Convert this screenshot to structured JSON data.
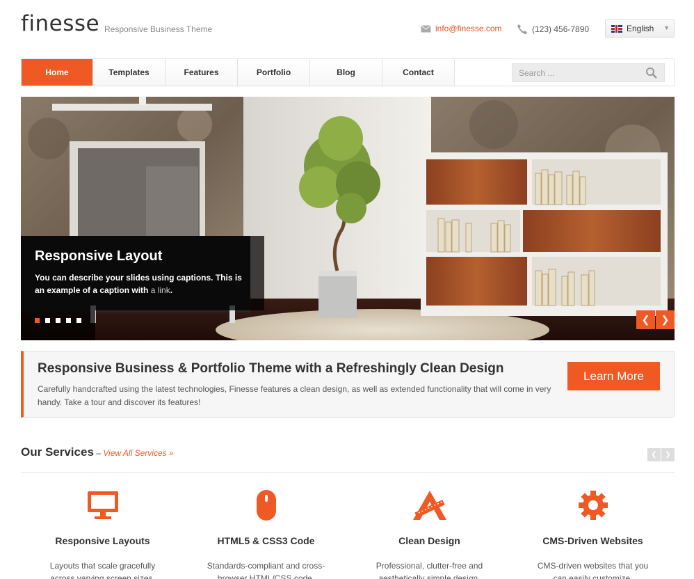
{
  "header": {
    "logo": "finesse",
    "tagline": "Responsive Business Theme",
    "email": "info@finesse.com",
    "phone": "(123) 456-7890",
    "language": "English"
  },
  "nav": {
    "items": [
      {
        "label": "Home"
      },
      {
        "label": "Templates"
      },
      {
        "label": "Features"
      },
      {
        "label": "Portfolio"
      },
      {
        "label": "Blog"
      },
      {
        "label": "Contact"
      }
    ],
    "search_placeholder": "Search ..."
  },
  "slider": {
    "caption_title": "Responsive Layout",
    "caption_text": "You can describe your slides using captions. This is an example of a caption with",
    "caption_link": "a link",
    "caption_end": ".",
    "slide_count": 5,
    "active_slide": 1
  },
  "intro": {
    "title": "Responsive Business & Portfolio Theme with a Refreshingly Clean Design",
    "text": "Carefully handcrafted using the latest technologies, Finesse features a clean design, as well as extended functionality that will come in very handy. Take a tour and discover its features!",
    "button": "Learn More"
  },
  "services": {
    "title": "Our Services",
    "dash": " – ",
    "link": "View All Services »",
    "items": [
      {
        "icon": "monitor-icon",
        "title": "Responsive Layouts",
        "text": "Layouts that scale gracefully across varying screen sizes."
      },
      {
        "icon": "mouse-icon",
        "title": "HTML5 & CSS3 Code",
        "text": "Standards-compliant and cross-browser HTML/CSS code."
      },
      {
        "icon": "design-tools-icon",
        "title": "Clean Design",
        "text": "Professional, clutter-free and aesthetically simple design."
      },
      {
        "icon": "gear-icon",
        "title": "CMS-Driven Websites",
        "text": "CMS-driven websites that you can easily customize."
      }
    ]
  },
  "colors": {
    "accent": "#ef5a24",
    "text": "#333333",
    "border": "#e2e2e2"
  }
}
